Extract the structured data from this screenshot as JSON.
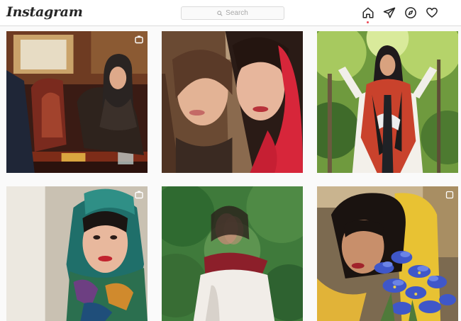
{
  "app": {
    "title": "Instagram"
  },
  "search": {
    "placeholder": "Search"
  },
  "nav": [
    {
      "icon": "home-icon",
      "active": true
    },
    {
      "icon": "direct-message-icon",
      "active": false
    },
    {
      "icon": "explore-compass-icon",
      "active": false
    },
    {
      "icon": "activity-heart-icon",
      "active": false
    }
  ],
  "posts": [
    {
      "subject": "woman in dark hijab seated in ornate red chair on TV set",
      "badge": "igtv-icon"
    },
    {
      "subject": "two women selfie, one wearing red scarf",
      "badge": null
    },
    {
      "subject": "woman in patterned red scarf in forest",
      "badge": null
    },
    {
      "subject": "woman in teal patterned headscarf, red lipstick",
      "badge": "igtv-icon"
    },
    {
      "subject": "woman with red scarf, motion blur, green forest",
      "badge": null
    },
    {
      "subject": "woman holding blue iris flowers, yellow scarf",
      "badge": "carousel-icon"
    }
  ],
  "colors": {
    "accent_dot": "#ed4956",
    "border": "#dbdbdb",
    "text": "#262626"
  }
}
